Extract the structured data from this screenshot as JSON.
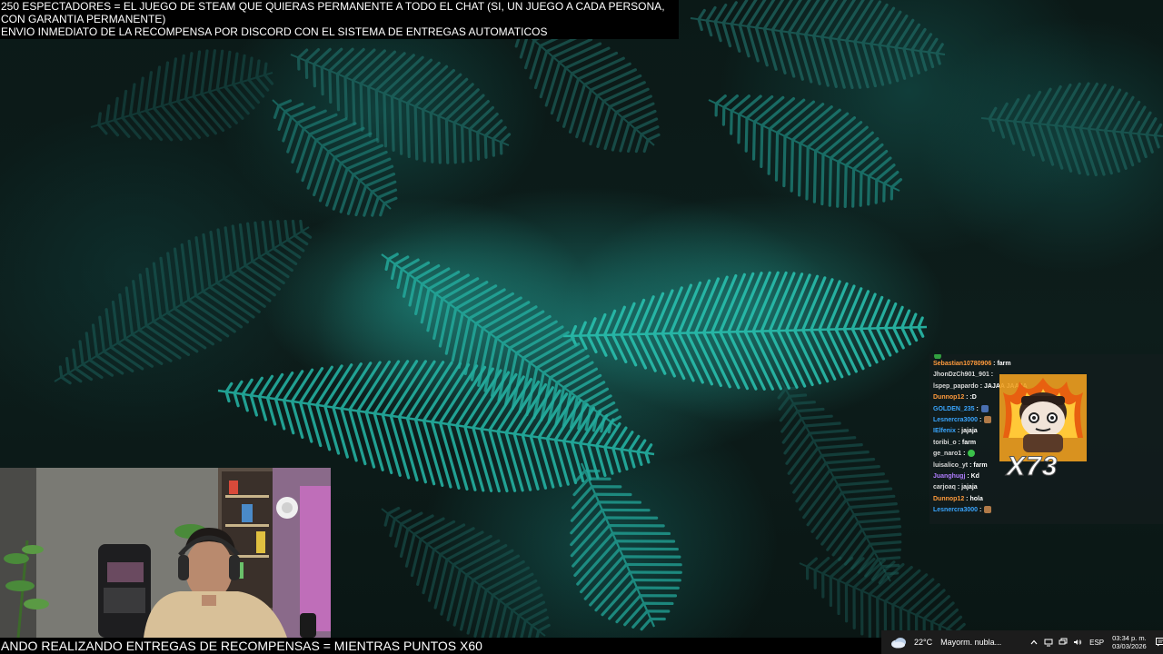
{
  "notice": {
    "line1": "250 ESPECTADORES = EL JUEGO DE STEAM QUE QUIERAS PERMANENTE A TODO EL CHAT (SI, UN JUEGO A CADA PERSONA, CON GARANTIA PERMANENTE)",
    "line2": "ENVIO INMEDIATO DE LA RECOMPENSA POR DISCORD CON EL SISTEMA DE ENTREGAS AUTOMATICOS"
  },
  "chat": {
    "messages": [
      {
        "user": "Sebastian10780906",
        "color": "#ff9a3c",
        "text": "farm",
        "emote": ""
      },
      {
        "user": "JhonDzCh901_901",
        "color": "#d8d8d8",
        "text": "",
        "emote": ""
      },
      {
        "user": "lspep_papardo",
        "color": "#d8d8d8",
        "text": "JAJAA JAAJA",
        "emote": ""
      },
      {
        "user": "Dunnop12",
        "color": "#ff9a3c",
        "text": ":D",
        "emote": ""
      },
      {
        "user": "GOLDEN_235",
        "color": "#3aa6ff",
        "text": "",
        "emote": "blue"
      },
      {
        "user": "Lesnercra3000",
        "color": "#3aa6ff",
        "text": "",
        "emote": "face"
      },
      {
        "user": "IElfenix",
        "color": "#3aa6ff",
        "text": "jajaja",
        "emote": ""
      },
      {
        "user": "toribi_o",
        "color": "#d8d8d8",
        "text": "farm",
        "emote": ""
      },
      {
        "user": "ge_naro1",
        "color": "#d8d8d8",
        "text": "",
        "emote": "green"
      },
      {
        "user": "luisalico_yt",
        "color": "#d8d8d8",
        "text": "farm",
        "emote": ""
      },
      {
        "user": "Juanghugj",
        "color": "#b07cff",
        "text": "Kd",
        "emote": ""
      },
      {
        "user": "carjoaq",
        "color": "#d8d8d8",
        "text": "jajaja",
        "emote": ""
      },
      {
        "user": "Dunnop12",
        "color": "#ff9a3c",
        "text": "hola",
        "emote": ""
      },
      {
        "user": "Lesnercra3000",
        "color": "#3aa6ff",
        "text": "",
        "emote": "face"
      }
    ],
    "sticker_text": "X73"
  },
  "ticker": {
    "text": "ANDO REALIZANDO ENTREGAS DE RECOMPENSAS = MIENTRAS PUNTOS X60"
  },
  "taskbar": {
    "weather_temp": "22°C",
    "weather_desc": "Mayorm. nubla...",
    "lang": "ESP",
    "time": "03:34 p. m.",
    "date": "03/03/2026"
  }
}
